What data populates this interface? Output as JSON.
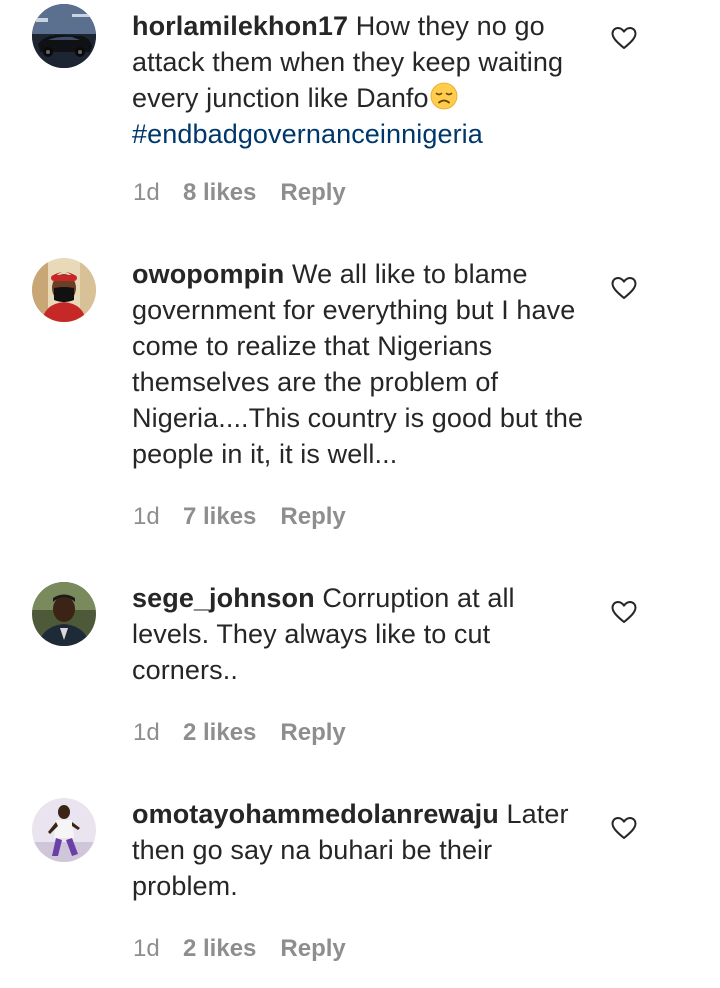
{
  "comments": [
    {
      "username": "horlamilekhon17",
      "text": "How they no go attack them when they keep waiting every junction like Danfo",
      "hashtag": "#endbadgovernanceinnigeria",
      "time": "1d",
      "likes": "8 likes",
      "reply": "Reply"
    },
    {
      "username": "owopompin",
      "text": "We all like to blame government for everything but I have come to realize that Nigerians themselves are the problem of Nigeria....This country is good but the people in it, it is well...",
      "time": "1d",
      "likes": "7 likes",
      "reply": "Reply"
    },
    {
      "username": "sege_johnson",
      "text": "Corruption at all levels. They always like to cut corners..",
      "time": "1d",
      "likes": "2 likes",
      "reply": "Reply"
    },
    {
      "username": "omotayohammedolanrewaju",
      "text": "Later then go say na buhari be their problem.",
      "time": "1d",
      "likes": "2 likes",
      "reply": "Reply"
    }
  ],
  "icons": {
    "like": "heart-outline-icon",
    "emoji": "disappointed-face-emoji"
  },
  "colors": {
    "text": "#262626",
    "secondary": "#8e8e8e",
    "hashtag": "#00376b"
  }
}
